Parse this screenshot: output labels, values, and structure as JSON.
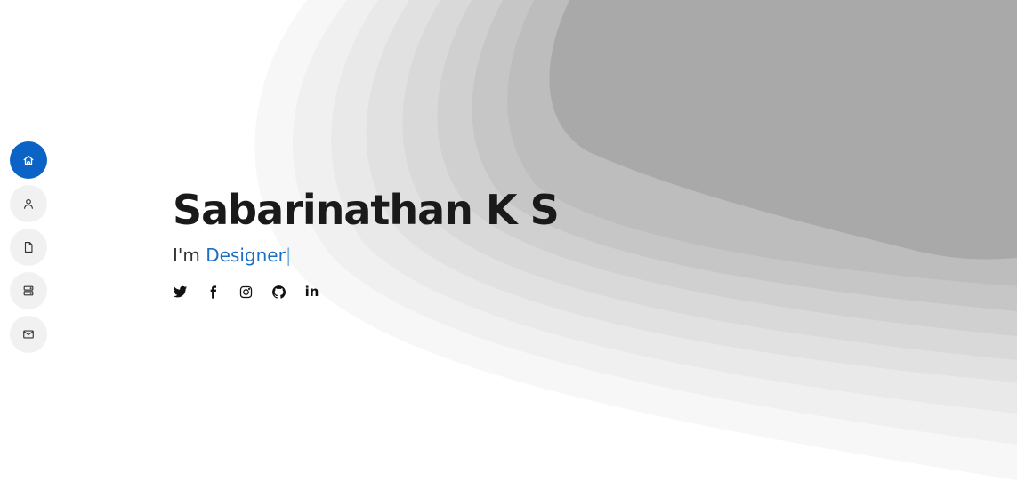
{
  "hero": {
    "name": "Sabarinathan K S",
    "tagline_prefix": "I'm ",
    "role": "Designer",
    "cursor": "|"
  },
  "side_nav": {
    "items": [
      {
        "icon": "home-icon",
        "active": true
      },
      {
        "icon": "user-icon",
        "active": false
      },
      {
        "icon": "file-icon",
        "active": false
      },
      {
        "icon": "server-icon",
        "active": false
      },
      {
        "icon": "envelope-icon",
        "active": false
      }
    ]
  },
  "socials": {
    "items": [
      {
        "icon": "twitter-icon"
      },
      {
        "icon": "facebook-icon"
      },
      {
        "icon": "instagram-icon"
      },
      {
        "icon": "github-icon"
      },
      {
        "icon": "linkedin-icon",
        "text": "in"
      }
    ]
  },
  "colors": {
    "accent": "#0b63c6",
    "role_text": "#1b6ec2",
    "name_text": "#1a1a1a",
    "nav_bg": "#f1f1f1"
  }
}
